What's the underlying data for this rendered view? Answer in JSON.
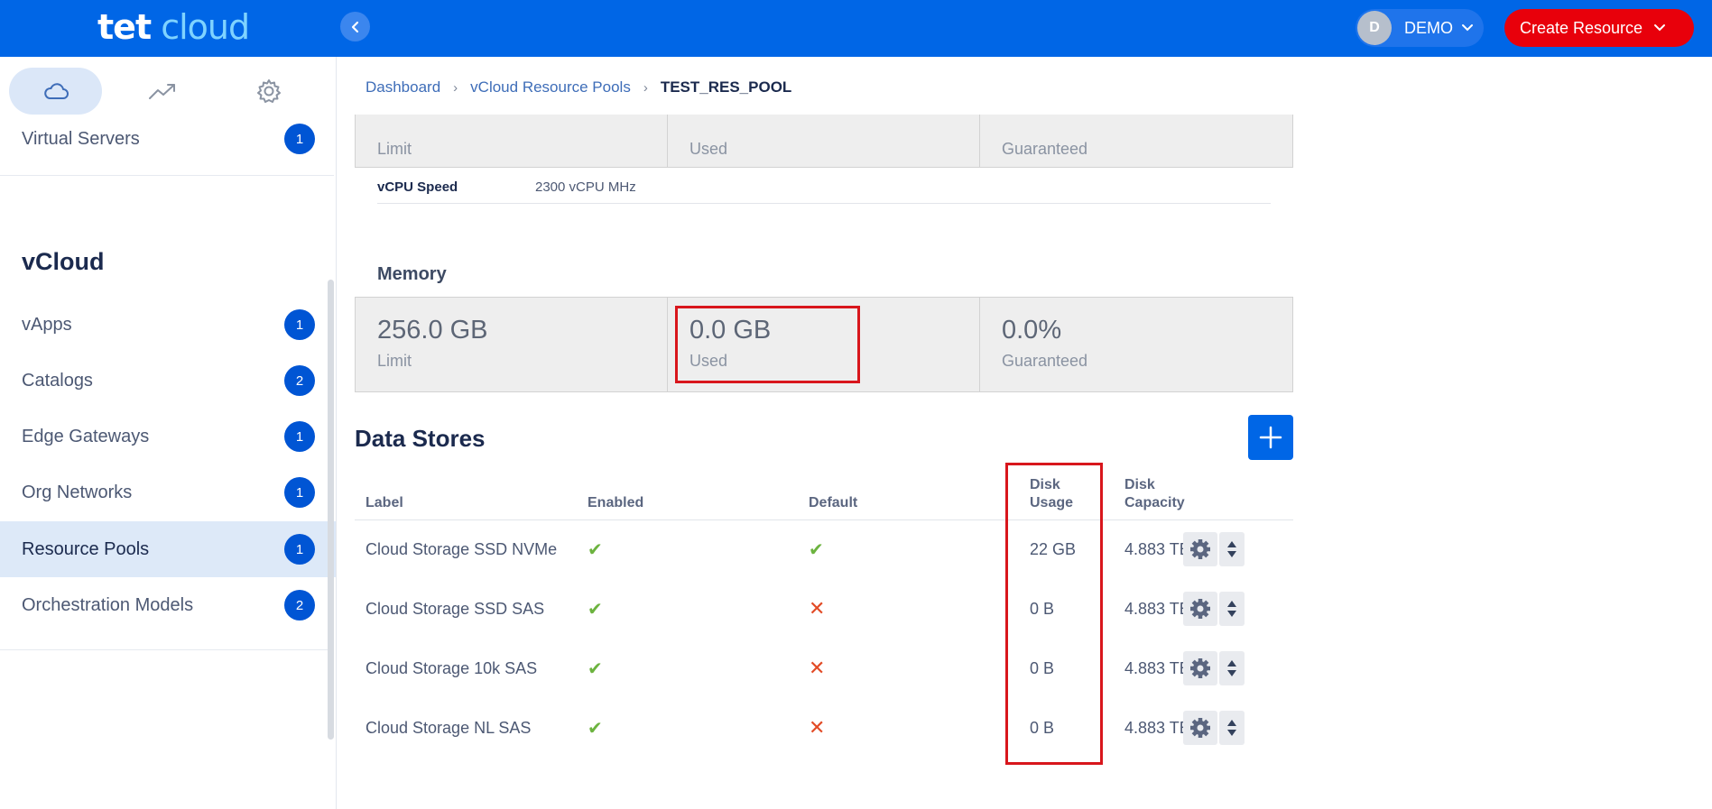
{
  "brand": {
    "logo_tet": "tet",
    "logo_cloud": "cloud"
  },
  "header": {
    "user_initial": "D",
    "user_name": "DEMO",
    "create_label": "Create Resource"
  },
  "sidebar": {
    "tabs": [
      "cloud-icon",
      "trend-icon",
      "gear-icon"
    ],
    "top_items": [
      {
        "label": "Virtual Servers",
        "count": "1"
      }
    ],
    "section_title": "vCloud",
    "items": [
      {
        "label": "vApps",
        "count": "1"
      },
      {
        "label": "Catalogs",
        "count": "2"
      },
      {
        "label": "Edge Gateways",
        "count": "1"
      },
      {
        "label": "Org Networks",
        "count": "1"
      },
      {
        "label": "Resource Pools",
        "count": "1",
        "active": true
      },
      {
        "label": "Orchestration Models",
        "count": "2"
      }
    ]
  },
  "breadcrumb": {
    "items": [
      "Dashboard",
      "vCloud Resource Pools"
    ],
    "current": "TEST_RES_POOL"
  },
  "cpu": {
    "limit_label": "Limit",
    "used_label": "Used",
    "guaranteed_label": "Guaranteed",
    "speed_label": "vCPU Speed",
    "speed_value": "2300 vCPU MHz"
  },
  "memory": {
    "title": "Memory",
    "limit_value": "256.0 GB",
    "limit_label": "Limit",
    "used_value": "0.0 GB",
    "used_label": "Used",
    "guaranteed_value": "0.0%",
    "guaranteed_label": "Guaranteed"
  },
  "datastores": {
    "title": "Data Stores",
    "columns": {
      "label": "Label",
      "enabled": "Enabled",
      "default": "Default",
      "disk_usage_1": "Disk",
      "disk_usage_2": "Usage",
      "disk_capacity_1": "Disk",
      "disk_capacity_2": "Capacity"
    },
    "rows": [
      {
        "label": "Cloud Storage SSD NVMe",
        "enabled": true,
        "default": true,
        "usage": "22 GB",
        "capacity": "4.883 TB"
      },
      {
        "label": "Cloud Storage SSD SAS",
        "enabled": true,
        "default": false,
        "usage": "0 B",
        "capacity": "4.883 TB"
      },
      {
        "label": "Cloud Storage 10k SAS",
        "enabled": true,
        "default": false,
        "usage": "0 B",
        "capacity": "4.883 TB"
      },
      {
        "label": "Cloud Storage NL SAS",
        "enabled": true,
        "default": false,
        "usage": "0 B",
        "capacity": "4.883 TB"
      }
    ]
  },
  "colors": {
    "primary": "#0066e6",
    "danger": "#e8000b",
    "success": "#6cb33f",
    "highlight_box": "#d8161c"
  }
}
